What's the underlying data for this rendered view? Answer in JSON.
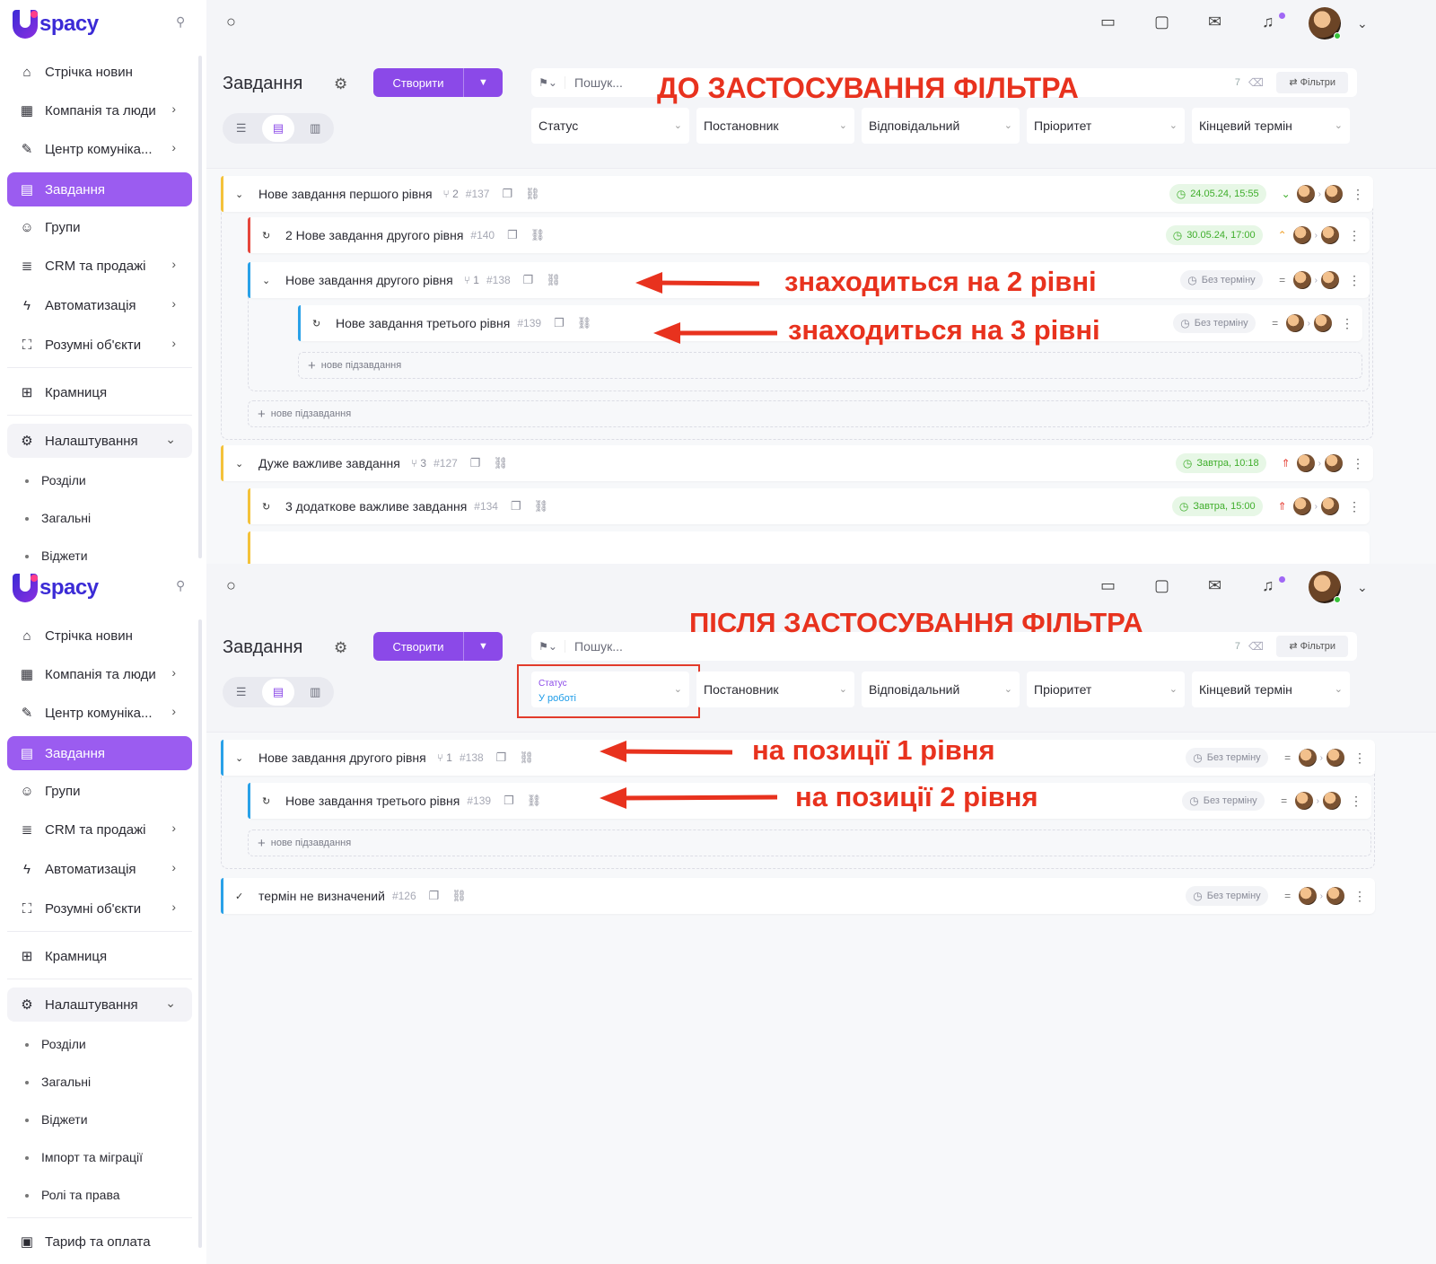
{
  "app": {
    "name": "spacy"
  },
  "sidebar": {
    "items": [
      {
        "label": "Стрічка новин",
        "icon": "home-icon"
      },
      {
        "label": "Компанія та люди",
        "icon": "building-icon"
      },
      {
        "label": "Центр комуніка...",
        "icon": "edit-icon"
      },
      {
        "label": "Завдання",
        "icon": "calendar-icon"
      },
      {
        "label": "Групи",
        "icon": "users-icon"
      },
      {
        "label": "CRM та продажі",
        "icon": "database-icon"
      },
      {
        "label": "Автоматизація",
        "icon": "bolt-icon"
      },
      {
        "label": "Розумні об'єкти",
        "icon": "scan-icon"
      },
      {
        "label": "Крамниця",
        "icon": "store-icon"
      },
      {
        "label": "Налаштування",
        "icon": "gear-icon"
      }
    ],
    "settings_sub": [
      "Розділи",
      "Загальні",
      "Віджети",
      "Імпорт та міграції",
      "Ролі та права"
    ],
    "billing": "Тариф та оплата"
  },
  "header": {
    "title": "Завдання",
    "create_label": "Створити",
    "search_placeholder": "Пошук...",
    "count": "7",
    "filters_label": "Фільтри"
  },
  "filters": {
    "status": "Статус",
    "status_value": "У роботі",
    "author": "Постановник",
    "responsible": "Відповідальний",
    "priority": "Пріоритет",
    "deadline": "Кінцевий термін"
  },
  "annotations": {
    "before": "ДО ЗАСТОСУВАННЯ ФІЛЬТРА",
    "after": "ПІСЛЯ ЗАСТОСУВАННЯ ФІЛЬТРА",
    "level2": "знаходиться на 2 рівні",
    "level3": "знаходиться на 3 рівні",
    "pos1": "на позиції 1 рівня",
    "pos2": "на позиції 2 рівня"
  },
  "add_subtask": "нове підзавдання",
  "tasks_before": [
    {
      "title": "Нове завдання першого рівня",
      "count": "2",
      "num": "#137",
      "deadline": "24.05.24, 15:55"
    },
    {
      "title": "2 Нове завдання другого рівня",
      "num": "#140",
      "deadline": "30.05.24, 17:00"
    },
    {
      "title": "Нове завдання другого рівня",
      "count": "1",
      "num": "#138",
      "deadline": "Без терміну"
    },
    {
      "title": "Нове завдання третього рівня",
      "num": "#139",
      "deadline": "Без терміну"
    },
    {
      "title": "Дуже важливе завдання",
      "count": "3",
      "num": "#127",
      "deadline": "Завтра, 10:18"
    },
    {
      "title": "3 додаткове важливе завдання",
      "num": "#134",
      "deadline": "Завтра, 15:00"
    }
  ],
  "tasks_after": [
    {
      "title": "Нове завдання другого рівня",
      "count": "1",
      "num": "#138",
      "deadline": "Без терміну"
    },
    {
      "title": "Нове завдання третього рівня",
      "num": "#139",
      "deadline": "Без терміну"
    },
    {
      "title": "термін не визначений",
      "num": "#126",
      "deadline": "Без терміну"
    }
  ],
  "colors": {
    "accent": "#8b49e8",
    "yellow": "#f4c23a",
    "red": "#e6463c",
    "blue": "#29a1e8",
    "annotation": "#e8321e"
  }
}
